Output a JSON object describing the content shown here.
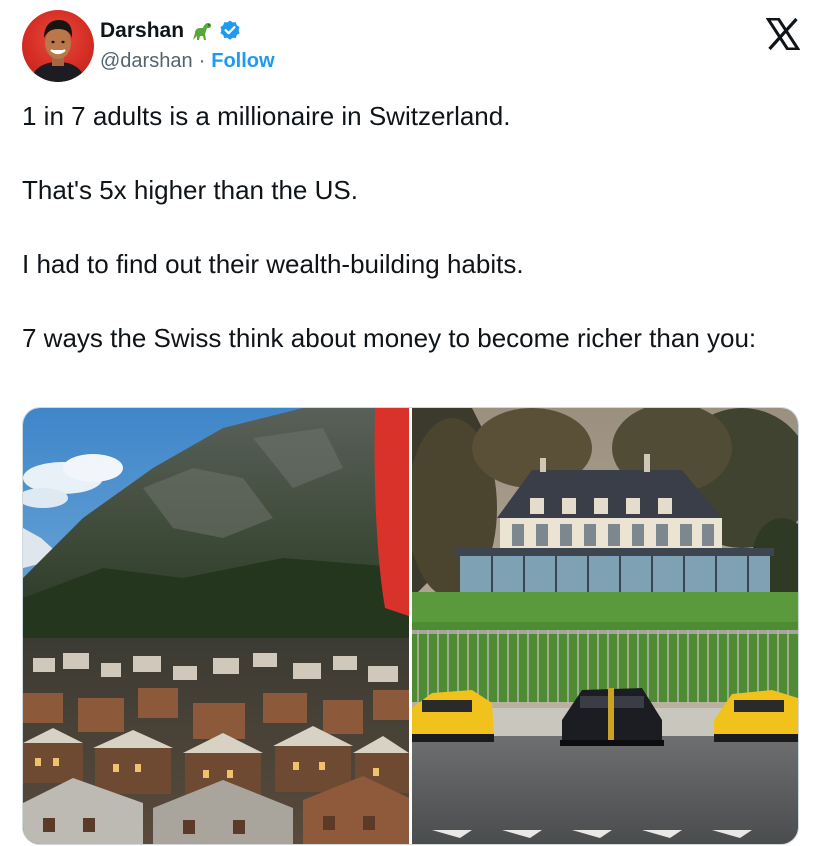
{
  "author": {
    "display_name": "Darshan",
    "handle": "@darshan",
    "separator": "·",
    "follow_label": "Follow",
    "emoji": "dinosaur-emoji",
    "verified": true,
    "accent_color": "#1d9bf0"
  },
  "platform": {
    "logo": "x-logo"
  },
  "tweet": {
    "paragraphs": [
      "1 in 7 adults is a millionaire in Switzerland.",
      "That's 5x higher than the US.",
      "I had to find out their wealth-building habits.",
      "7 ways the Swiss think about money to become richer than you:"
    ]
  },
  "media": {
    "photos": [
      {
        "subject": "swiss-alpine-village-photo"
      },
      {
        "subject": "mansion-with-supercars-photo"
      }
    ]
  }
}
